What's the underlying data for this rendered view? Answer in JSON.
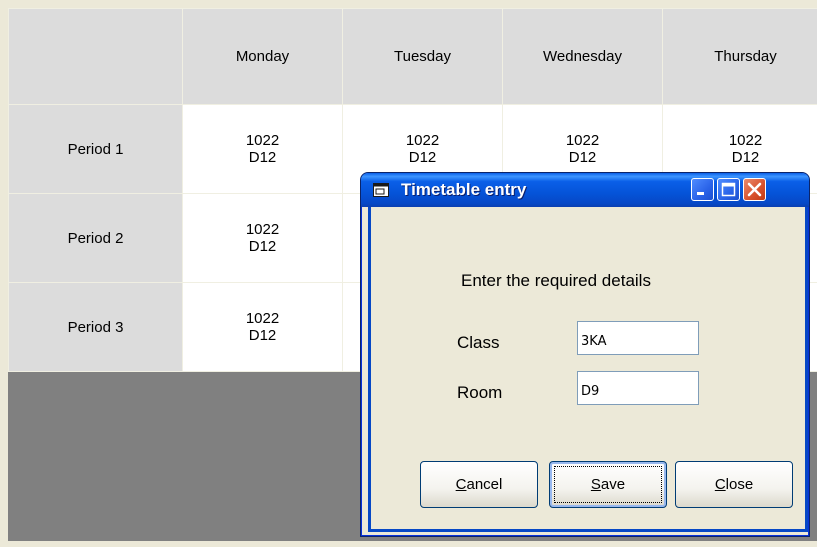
{
  "timetable": {
    "days": [
      "Monday",
      "Tuesday",
      "Wednesday",
      "Thursday"
    ],
    "periods": [
      {
        "label": "Period 1",
        "cells": [
          {
            "class": "1022",
            "room": "D12"
          },
          {
            "class": "1022",
            "room": "D12"
          },
          {
            "class": "1022",
            "room": "D12"
          },
          {
            "class": "1022",
            "room": "D12"
          }
        ]
      },
      {
        "label": "Period 2",
        "cells": [
          {
            "class": "1022",
            "room": "D12"
          },
          {
            "class": "",
            "room": ""
          },
          {
            "class": "",
            "room": ""
          },
          {
            "class": "",
            "room": ""
          }
        ]
      },
      {
        "label": "Period 3",
        "cells": [
          {
            "class": "1022",
            "room": "D12"
          },
          {
            "class": "",
            "room": ""
          },
          {
            "class": "",
            "room": ""
          },
          {
            "class": "",
            "room": ""
          }
        ]
      }
    ]
  },
  "dialog": {
    "title": "Timetable entry",
    "prompt": "Enter the required details",
    "class_label": "Class",
    "class_value": "3KA",
    "room_label": "Room",
    "room_value": "D9",
    "buttons": {
      "cancel": {
        "mnemonic": "C",
        "rest": "ancel"
      },
      "save": {
        "mnemonic": "S",
        "rest": "ave"
      },
      "close": {
        "mnemonic": "C",
        "rest": "lose"
      }
    }
  },
  "colors": {
    "titlebar": "#0553d8",
    "close_button": "#d8512c",
    "grid_header": "#dcdcdc",
    "grid_background": "#808080"
  },
  "icons": {
    "title_icon": "window-app-icon",
    "minimize": "minimize-icon",
    "maximize": "maximize-icon",
    "close": "close-icon"
  }
}
